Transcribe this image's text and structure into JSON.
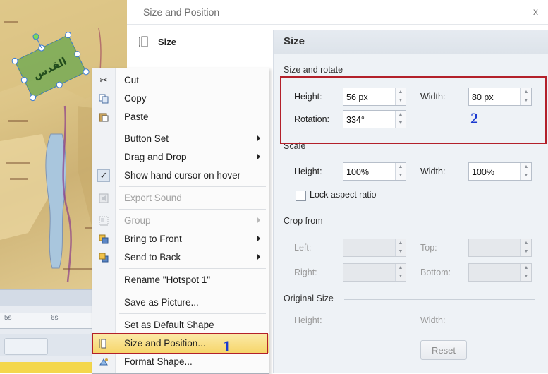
{
  "dialog": {
    "title": "Size and Position",
    "close_label": "x",
    "sidebar_item": "Size",
    "pane_title": "Size",
    "size_rotate": {
      "group": "Size and rotate",
      "height_label": "Height:",
      "height_value": "56 px",
      "width_label": "Width:",
      "width_value": "80 px",
      "rotation_label": "Rotation:",
      "rotation_value": "334°"
    },
    "scale": {
      "group": "Scale",
      "height_label": "Height:",
      "height_value": "100%",
      "width_label": "Width:",
      "width_value": "100%",
      "lock_label": "Lock aspect ratio"
    },
    "crop": {
      "group": "Crop from",
      "left_label": "Left:",
      "top_label": "Top:",
      "right_label": "Right:",
      "bottom_label": "Bottom:"
    },
    "original": {
      "group": "Original Size",
      "height_label": "Height:",
      "width_label": "Width:",
      "reset_label": "Reset"
    }
  },
  "annotations": {
    "n1": "1",
    "n2": "2"
  },
  "timeline": {
    "t1": "5s",
    "t2": "6s"
  },
  "map": {
    "label": "القدس"
  },
  "menu": {
    "cut": "Cut",
    "copy": "Copy",
    "paste": "Paste",
    "button_set": "Button Set",
    "drag_drop": "Drag and Drop",
    "show_hand": "Show hand cursor on hover",
    "export_sound": "Export Sound",
    "group": "Group",
    "bring_front": "Bring to Front",
    "send_back": "Send to Back",
    "rename": "Rename \"Hotspot 1\"",
    "save_picture": "Save as Picture...",
    "set_default": "Set as Default Shape",
    "size_position": "Size and Position...",
    "format_shape": "Format Shape..."
  },
  "colors": {
    "highlight_box": "#b3202a",
    "annotation_number": "#1b3ad0",
    "menu_hover": "#f6d66b"
  }
}
